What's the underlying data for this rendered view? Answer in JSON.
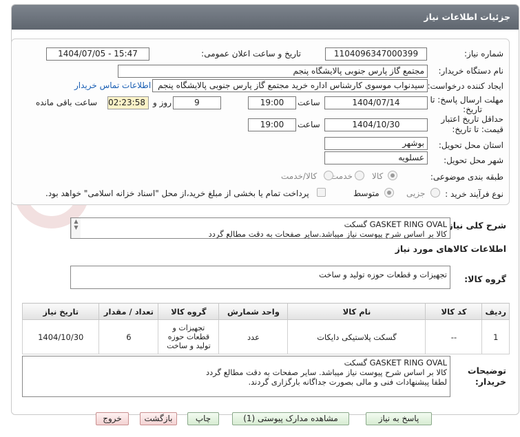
{
  "header": {
    "title": "جزئیات اطلاعات نیاز"
  },
  "fields": {
    "need_number_label": "شماره نیاز:",
    "need_number": "1104096347000399",
    "announce_label": "تاریخ و ساعت اعلان عمومی:",
    "announce_value": "1404/07/05 - 15:47",
    "buyer_label": "نام دستگاه خریدار:",
    "buyer_value": "مجتمع گاز پارس جنوبی  پالایشگاه پنجم",
    "creator_label": "ایجاد کننده درخواست:",
    "creator_value": "سیدنواب موسوی کارشناس اداره خرید مجتمع گاز پارس جنوبی  پالایشگاه پنجم",
    "contact_link": "اطلاعات تماس خریدار",
    "deadline_label_1": "مهلت ارسال پاسخ: تا",
    "deadline_label_2": "تاریخ:",
    "deadline_date": "1404/07/14",
    "time_label": "ساعت",
    "deadline_time": "19:00",
    "days_value": "9",
    "days_label": "روز و",
    "remaining_time": "02:23:58",
    "remaining_label": "ساعت باقی مانده",
    "validity_label_1": "حداقل تاریخ اعتبار",
    "validity_label_2": "قیمت: تا تاریخ:",
    "validity_date": "1404/10/30",
    "validity_time": "19:00",
    "province_label": "استان محل تحویل:",
    "province_value": "بوشهر",
    "city_label": "شهر محل تحویل:",
    "city_value": "عسلویه",
    "category_label": "طبقه بندی موضوعی:",
    "category_options": [
      "کالا",
      "خدمت",
      "کالا/خدمت"
    ],
    "process_label": "نوع فرآیند خرید :",
    "process_options": [
      "جزیی",
      "متوسط"
    ],
    "payment_note": "پرداخت تمام یا بخشی از مبلغ خرید،از محل \"اسناد خزانه اسلامی\" خواهد بود."
  },
  "watermark": {
    "text": "AriaTender.neT"
  },
  "general_desc": {
    "label": "شرح کلی نیاز:",
    "line1": "GASKET RING OVAL گسکت",
    "line2": "کالا بر اساس شرح پیوست نیاز میباشد.سایر صفحات به دقت مطالع گردد"
  },
  "goods_info": {
    "title": "اطلاعات کالاهای مورد نیاز",
    "group_label": "گروه کالا:",
    "group_value": "تجهیزات و قطعات حوزه تولید و ساخت"
  },
  "table": {
    "headers": [
      "ردیف",
      "کد کالا",
      "نام کالا",
      "واحد شمارش",
      "گروه کالا",
      "تعداد / مقدار",
      "تاریخ نیاز"
    ],
    "rows": [
      [
        "1",
        "--",
        "گسکت پلاستیکی دایکات",
        "عدد",
        "تجهیزات و قطعات حوزه تولید و ساخت",
        "6",
        "1404/10/30"
      ]
    ]
  },
  "buyer_notes": {
    "label_1": "توضیحات",
    "label_2": "خریدار:",
    "line1": "GASKET RING OVAL گسکت",
    "line2": "کالا بر اساس شرح پیوست نیاز میباشد. سایر صفحات به دقت مطالع گردد",
    "line3": "لطفا پیشنهادات فنی و مالی بصورت جداگانه بارگزاری گردند."
  },
  "buttons": {
    "respond": "پاسخ به نیاز",
    "attachments": "مشاهده مدارک پیوستی (1)",
    "print": "چاپ",
    "back": "بازگشت",
    "exit": "خروج"
  }
}
